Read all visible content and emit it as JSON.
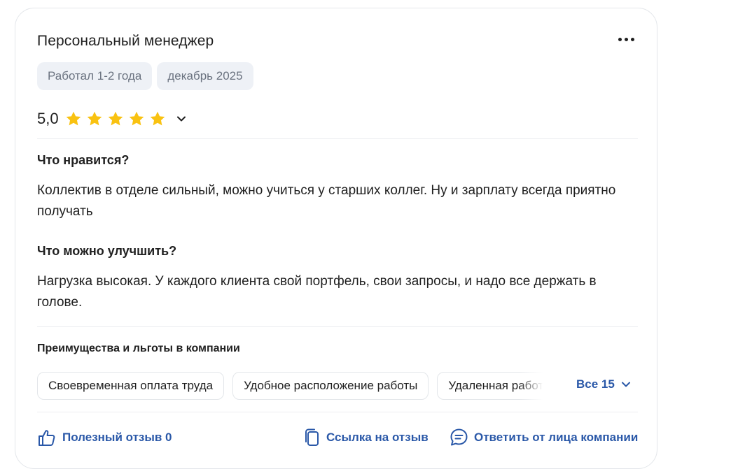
{
  "review": {
    "position": "Персональный менеджер",
    "tags": [
      "Работал 1-2 года",
      "декабрь 2025"
    ],
    "rating": "5,0",
    "rating_stars": 5,
    "colors": {
      "star": "#f9c211",
      "link": "#2a58a8",
      "chip_bg": "#eef1f6"
    },
    "likes_title": "Что нравится?",
    "likes_text": "Коллектив в отделе сильный, можно учиться у старших коллег. Ну и зарплату всегда приятно получать",
    "improve_title": "Что можно улучшить?",
    "improve_text": "Нагрузка высокая. У каждого клиента свой портфель, свои запросы, и надо все держать в голове."
  },
  "benefits": {
    "title": "Преимущества и льготы в компании",
    "items": [
      "Своевременная оплата труда",
      "Удобное расположение работы",
      "Удаленная работа"
    ],
    "all_label": "Все 15"
  },
  "actions": {
    "helpful": "Полезный отзыв 0",
    "link": "Ссылка на отзыв",
    "reply": "Ответить от лица компании"
  },
  "icons": [
    "more-dots-icon",
    "star-icon",
    "chevron-down-icon",
    "thumbs-up-icon",
    "copy-link-icon",
    "chat-bubble-icon"
  ]
}
